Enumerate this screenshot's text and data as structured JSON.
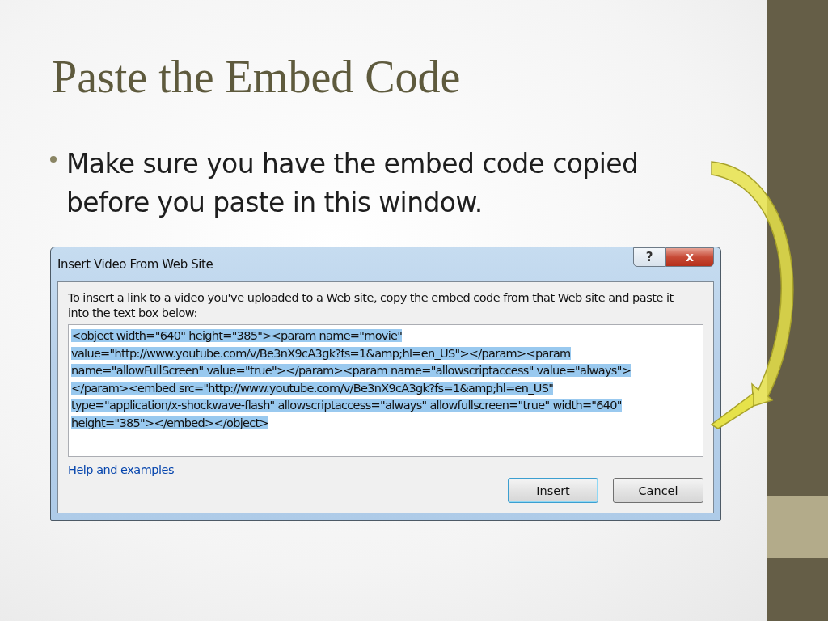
{
  "slide": {
    "title": "Paste the Embed Code",
    "bullets": [
      "Make sure you have the embed code copied before you paste in this window."
    ]
  },
  "dialog": {
    "title": "Insert Video From Web Site",
    "help_button": "?",
    "close_button": "x",
    "instructions": "To insert a link to a video you've uploaded to a Web site, copy the embed code from that Web site and paste it into the text box below:",
    "code_box": {
      "selected": true,
      "lines": [
        "<object width=\"640\" height=\"385\"><param name=\"movie\"",
        "value=\"http://www.youtube.com/v/Be3nX9cA3gk?fs=1&amp;hl=en_US\"></param><param",
        "name=\"allowFullScreen\" value=\"true\"></param><param name=\"allowscriptaccess\" value=\"always\">",
        "</param><embed src=\"http://www.youtube.com/v/Be3nX9cA3gk?fs=1&amp;hl=en_US\"",
        "type=\"application/x-shockwave-flash\" allowscriptaccess=\"always\" allowfullscreen=\"true\" width=\"640\"",
        "height=\"385\"></embed></object>"
      ]
    },
    "help_link": "Help and examples",
    "buttons": [
      {
        "label": "Insert",
        "default": true
      },
      {
        "label": "Cancel",
        "default": false
      }
    ]
  }
}
